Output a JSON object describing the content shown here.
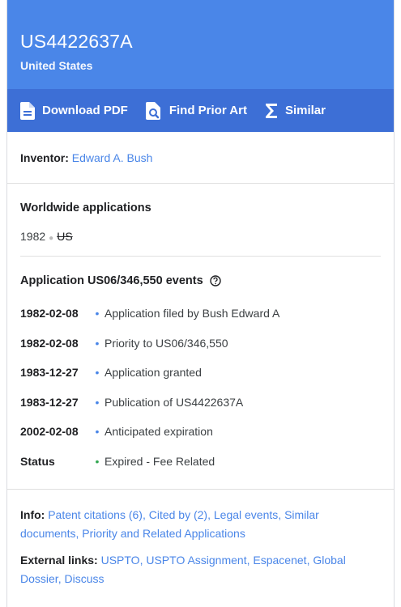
{
  "header": {
    "publication_number": "US4422637A",
    "country": "United States"
  },
  "actions": {
    "download_pdf": "Download PDF",
    "find_prior_art": "Find Prior Art",
    "similar": "Similar"
  },
  "inventor": {
    "label": "Inventor:",
    "name": "Edward A. Bush"
  },
  "worldwide": {
    "title": "Worldwide applications",
    "year": "1982",
    "country_code": "US"
  },
  "events": {
    "title": "Application US06/346,550 events",
    "items": [
      {
        "date": "1982-02-08",
        "text": "Application filed by Bush Edward A",
        "dot_color": "#4a86e8"
      },
      {
        "date": "1982-02-08",
        "text": "Priority to US06/346,550",
        "dot_color": "#4a86e8"
      },
      {
        "date": "1983-12-27",
        "text": "Application granted",
        "dot_color": "#4a86e8"
      },
      {
        "date": "1983-12-27",
        "text": "Publication of US4422637A",
        "dot_color": "#4a86e8"
      },
      {
        "date": "2002-02-08",
        "text": "Anticipated expiration",
        "dot_color": "#4a86e8"
      },
      {
        "date": "Status",
        "text": "Expired - Fee Related",
        "dot_color": "#34a853"
      }
    ]
  },
  "info": {
    "label": "Info:",
    "links": [
      "Patent citations (6)",
      "Cited by (2)",
      "Legal events",
      "Similar documents",
      "Priority and Related Applications"
    ]
  },
  "external": {
    "label": "External links:",
    "links": [
      "USPTO",
      "USPTO Assignment",
      "Espacenet",
      "Global Dossier",
      "Discuss"
    ]
  },
  "colors": {
    "header_bg": "#4a86e8",
    "actions_bg": "#3d6fd6",
    "link": "#4a86e8",
    "status_expired": "#34a853"
  }
}
